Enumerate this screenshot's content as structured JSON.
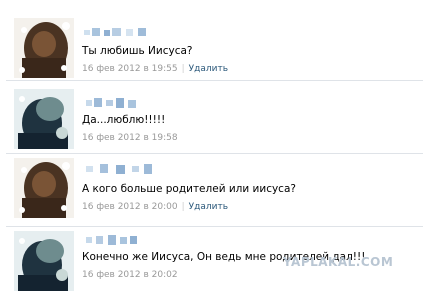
{
  "messages": [
    {
      "text": "Ты любишь Иисуса?",
      "date": "16 фев 2012 в 19:55",
      "delete_label": "Удалить"
    },
    {
      "text": "Да...люблю!!!!!",
      "date": "16 фев 2012 в 19:58"
    },
    {
      "text": "А кого больше родителей или иисуса?",
      "date": "16 фев 2012 в 20:00",
      "delete_label": "Удалить"
    },
    {
      "text": "Конечно же Иисуса, Он ведь мне родителей дал!!!",
      "date": "16 фев 2012 в 20:02"
    }
  ],
  "watermark": "YAPLAKAL.COM",
  "colors": {
    "link": "#2b587a",
    "meta": "#999999",
    "divider": "#dfe3e8"
  }
}
